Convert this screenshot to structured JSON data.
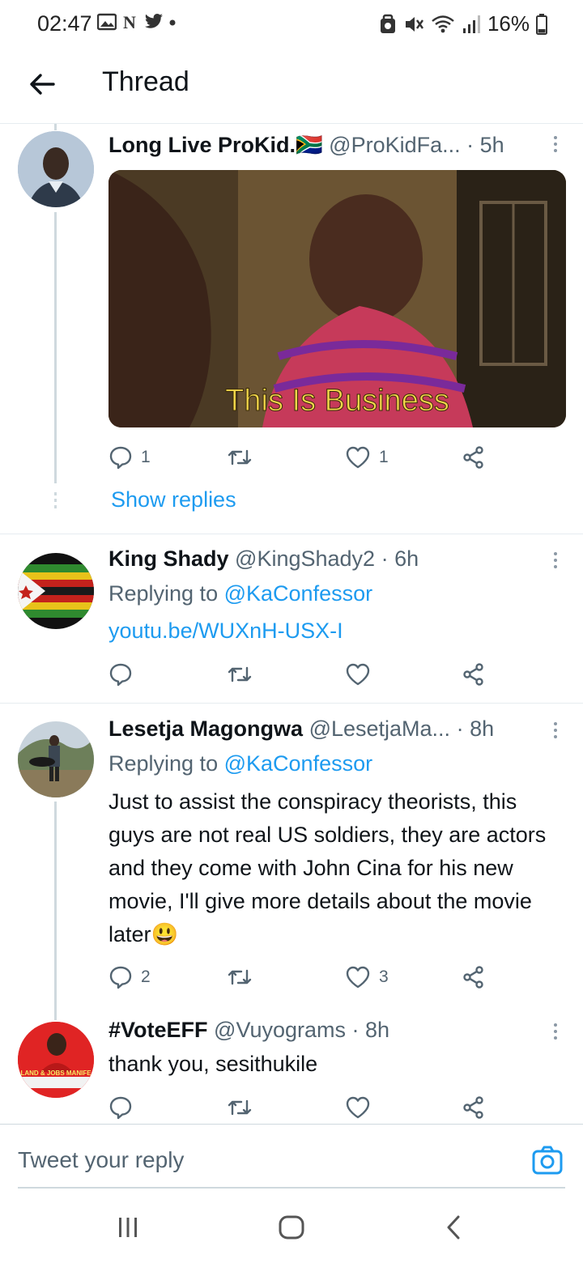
{
  "status_bar": {
    "time": "02:47",
    "left_icons": [
      "gallery-icon",
      "nyt-icon",
      "twitter-icon",
      "dot-icon"
    ],
    "right_icons": [
      "recycle-icon",
      "mute-icon",
      "wifi-icon",
      "signal-icon"
    ],
    "battery": "16%"
  },
  "header": {
    "title": "Thread"
  },
  "tweets": [
    {
      "name": "Long Live ProKid.",
      "flag": "🇿🇦",
      "handle": "@ProKidFa...",
      "time": "· 5h",
      "media_caption": "This Is Business",
      "reply_count": "1",
      "like_count": "1",
      "show_replies": "Show replies"
    },
    {
      "name": "King Shady",
      "handle": "@KingShady2",
      "time": "· 6h",
      "replying_prefix": "Replying to",
      "replying_handle": "@KaConfessor",
      "link": "youtu.be/WUXnH-USX-I"
    },
    {
      "name": "Lesetja Magongwa",
      "handle": "@LesetjaMa...",
      "time": "· 8h",
      "replying_prefix": "Replying to",
      "replying_handle": "@KaConfessor",
      "text": "Just to assist the conspiracy theorists, this guys are not real US soldiers, they are actors and they come with John Cina for his new movie, I'll give more details about the movie later😃",
      "reply_count": "2",
      "like_count": "3"
    },
    {
      "name": "#VoteEFF",
      "handle": "@Vuyograms",
      "time": "· 8h",
      "text": "thank you, sesithukile",
      "avatar_text": "LAND & JOBS MANIFE"
    }
  ],
  "reply_bar": {
    "placeholder": "Tweet your reply"
  },
  "nav_bar": {
    "buttons": [
      "recents-icon",
      "home-icon",
      "back-icon"
    ]
  },
  "colors": {
    "accent": "#1d9bf0",
    "text": "#0f1419",
    "secondary": "#536471",
    "divider": "#e6ecf0"
  }
}
